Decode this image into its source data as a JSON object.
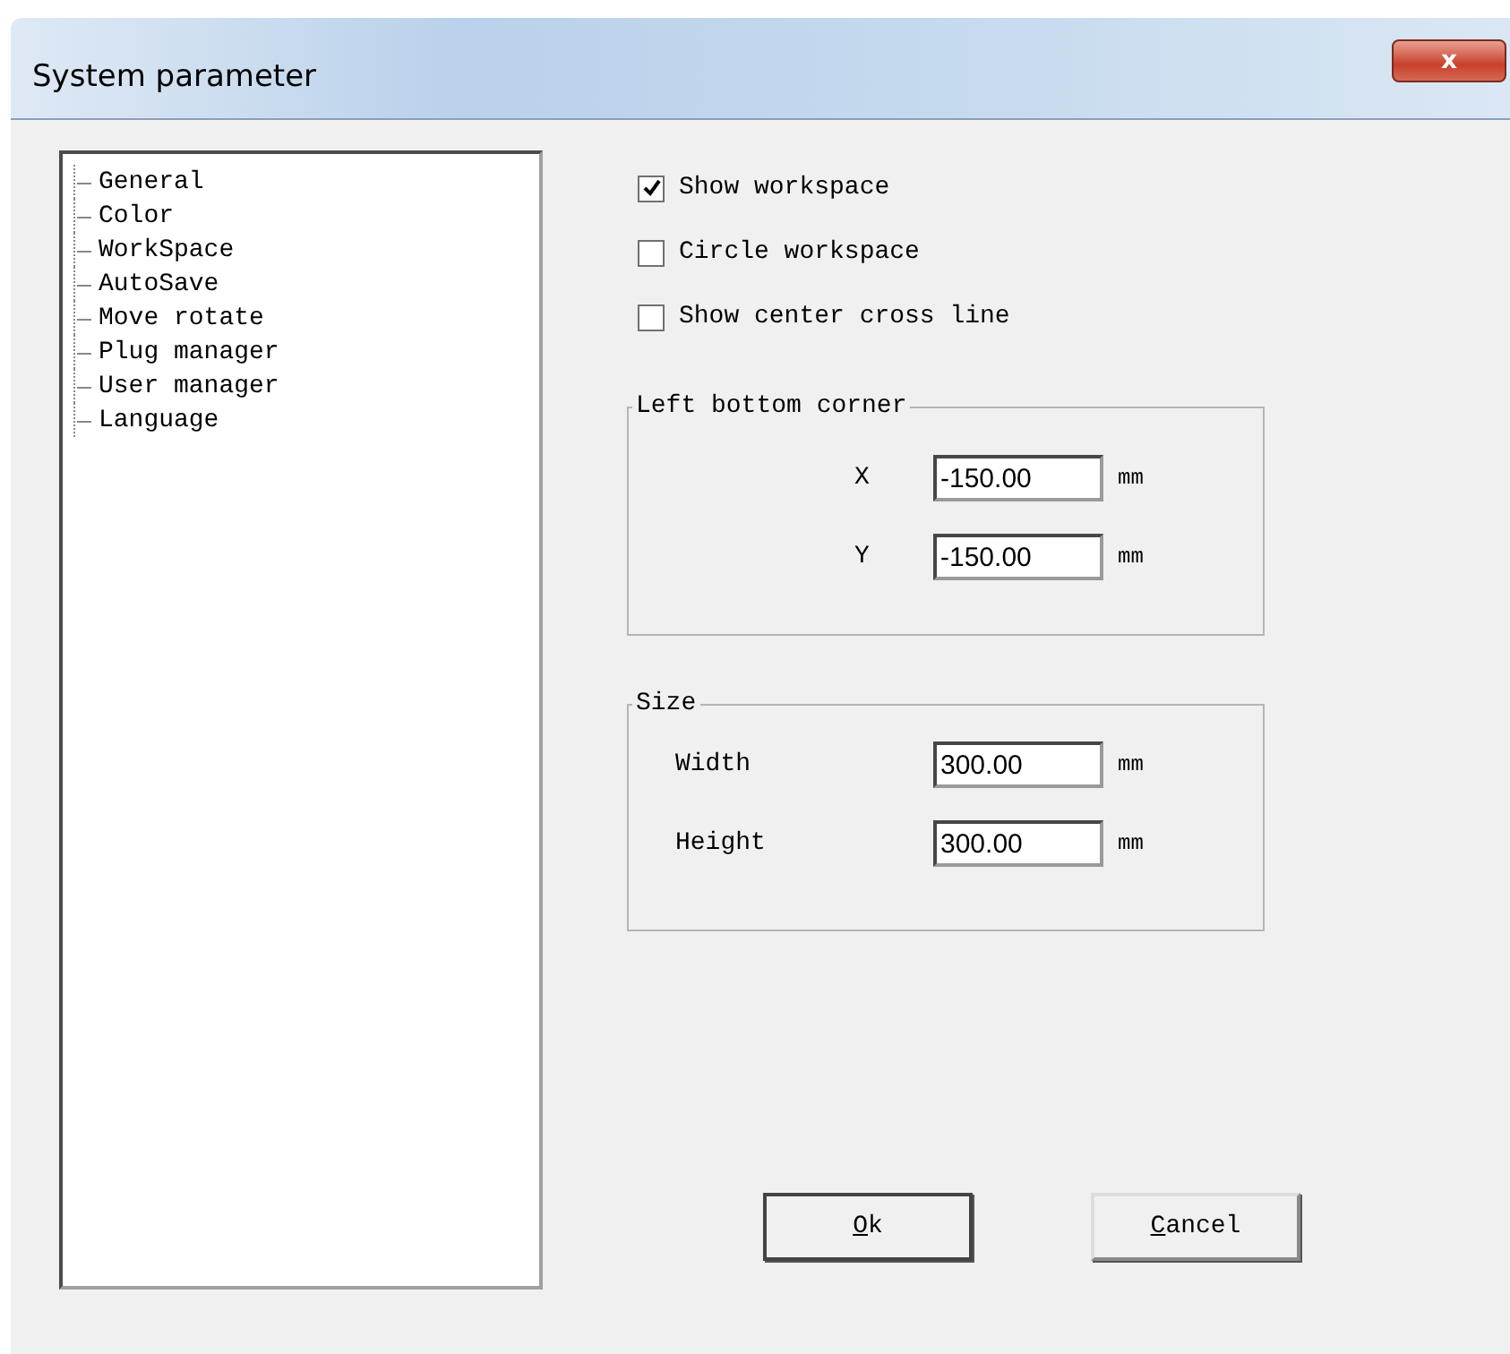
{
  "window": {
    "title": "System parameter",
    "close": "x"
  },
  "tree": {
    "items": [
      {
        "label": "General",
        "selected": false
      },
      {
        "label": "Color",
        "selected": false
      },
      {
        "label": "WorkSpace",
        "selected": false
      },
      {
        "label": "AutoSave",
        "selected": false
      },
      {
        "label": "Move rotate",
        "selected": false
      },
      {
        "label": "Plug manager",
        "selected": false
      },
      {
        "label": "User manager",
        "selected": false
      },
      {
        "label": "Language",
        "selected": false
      }
    ]
  },
  "options": [
    {
      "label": "Show workspace",
      "checked": true
    },
    {
      "label": "Circle workspace",
      "checked": false
    },
    {
      "label": "Show center cross line",
      "checked": false
    }
  ],
  "groups": [
    {
      "title": "Left bottom corner",
      "kind": "corner",
      "fields": [
        {
          "label": "X",
          "value": "-150.00",
          "unit": "mm"
        },
        {
          "label": "Y",
          "value": "-150.00",
          "unit": "mm"
        }
      ]
    },
    {
      "title": "Size",
      "kind": "size",
      "fields": [
        {
          "label": "Width",
          "value": "300.00",
          "unit": "mm"
        },
        {
          "label": "Height",
          "value": "300.00",
          "unit": "mm"
        }
      ]
    }
  ],
  "buttons": [
    {
      "label": "Ok",
      "default": true
    },
    {
      "label": "Cancel",
      "default": false
    }
  ]
}
